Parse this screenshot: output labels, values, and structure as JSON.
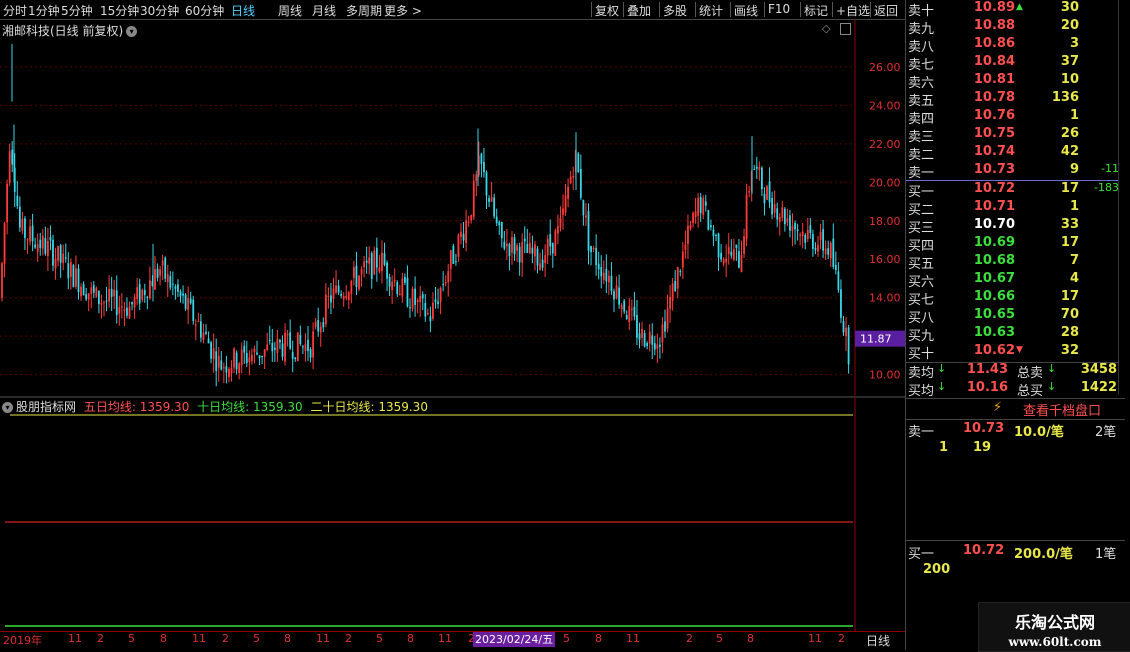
{
  "toolbar": {
    "left_items": [
      "分时",
      "1分钟",
      "5分钟",
      "15分钟",
      "30分钟",
      "60分钟",
      "日线",
      "周线",
      "月线",
      "多周期",
      "更多 >"
    ],
    "active_index": 6,
    "right_items": [
      "复权",
      "叠加",
      "多股",
      "统计",
      "画线",
      "F10",
      "标记",
      "+自选",
      "返回"
    ]
  },
  "chart": {
    "title": "湘邮科技(日线 前复权)",
    "price_ticks": [
      "26.00",
      "24.00",
      "22.00",
      "20.00",
      "18.00",
      "16.00",
      "14.00",
      "12.00",
      "10.00"
    ],
    "price_range": [
      9.2,
      27.4
    ],
    "current_price_label": "11.87",
    "current_price": 11.87,
    "up_color": "#ff3b3b",
    "down_color": "#38d6e6"
  },
  "indicator": {
    "name": "股朋指标网",
    "ma5_label": "五日均线: 1359.30",
    "ma10_label": "十日均线: 1359.30",
    "ma20_label": "二十日均线: 1359.30"
  },
  "date_axis": {
    "labels": [
      "2019年",
      "11",
      "2",
      "5",
      "8",
      "11",
      "2",
      "5",
      "8",
      "11",
      "2",
      "5",
      "8",
      "11",
      "2",
      "5",
      "8",
      "11",
      "2",
      "5",
      "8",
      "11",
      "2"
    ],
    "highlight": "2023/02/24/五",
    "period_label": "日线"
  },
  "order_book": {
    "sells": [
      {
        "label": "卖十",
        "price": "10.89",
        "vol": "30",
        "chg": "",
        "price_color": "red",
        "marker": "up"
      },
      {
        "label": "卖九",
        "price": "10.88",
        "vol": "20",
        "chg": "",
        "price_color": "red"
      },
      {
        "label": "卖八",
        "price": "10.86",
        "vol": "3",
        "chg": "",
        "price_color": "red"
      },
      {
        "label": "卖七",
        "price": "10.84",
        "vol": "37",
        "chg": "",
        "price_color": "red"
      },
      {
        "label": "卖六",
        "price": "10.81",
        "vol": "10",
        "chg": "",
        "price_color": "red"
      },
      {
        "label": "卖五",
        "price": "10.78",
        "vol": "136",
        "chg": "",
        "price_color": "red"
      },
      {
        "label": "卖四",
        "price": "10.76",
        "vol": "1",
        "chg": "",
        "price_color": "red"
      },
      {
        "label": "卖三",
        "price": "10.75",
        "vol": "26",
        "chg": "",
        "price_color": "red"
      },
      {
        "label": "卖二",
        "price": "10.74",
        "vol": "42",
        "chg": "",
        "price_color": "red"
      },
      {
        "label": "卖一",
        "price": "10.73",
        "vol": "9",
        "chg": "-11",
        "price_color": "red"
      }
    ],
    "buys": [
      {
        "label": "买一",
        "price": "10.72",
        "vol": "17",
        "chg": "-183",
        "price_color": "red"
      },
      {
        "label": "买二",
        "price": "10.71",
        "vol": "1",
        "chg": "",
        "price_color": "red"
      },
      {
        "label": "买三",
        "price": "10.70",
        "vol": "33",
        "chg": "",
        "price_color": "white"
      },
      {
        "label": "买四",
        "price": "10.69",
        "vol": "17",
        "chg": "",
        "price_color": "green"
      },
      {
        "label": "买五",
        "price": "10.68",
        "vol": "7",
        "chg": "",
        "price_color": "green"
      },
      {
        "label": "买六",
        "price": "10.67",
        "vol": "4",
        "chg": "",
        "price_color": "green"
      },
      {
        "label": "买七",
        "price": "10.66",
        "vol": "17",
        "chg": "",
        "price_color": "green"
      },
      {
        "label": "买八",
        "price": "10.65",
        "vol": "70",
        "chg": "",
        "price_color": "green"
      },
      {
        "label": "买九",
        "price": "10.63",
        "vol": "28",
        "chg": "",
        "price_color": "green"
      },
      {
        "label": "买十",
        "price": "10.62",
        "vol": "32",
        "chg": "",
        "price_color": "red",
        "marker": "down"
      }
    ],
    "avg_sell_label": "卖均",
    "avg_sell": "11.43",
    "total_sell_label": "总卖",
    "total_sell": "3458",
    "avg_buy_label": "买均",
    "avg_buy": "10.16",
    "total_buy_label": "总买",
    "total_buy": "1422",
    "depth_button": "查看千档盘口",
    "sell1_label": "卖一",
    "sell1_price": "10.73",
    "sell1_amount": "10.0/笔",
    "sell1_count": "2笔",
    "sell1_orders": [
      "1",
      "19"
    ],
    "buy1_label": "买一",
    "buy1_price": "10.72",
    "buy1_amount": "200.0/笔",
    "buy1_count": "1笔",
    "buy1_orders": [
      "200"
    ]
  },
  "watermark": {
    "line1": "乐淘公式网",
    "line2": "www.60lt.com"
  }
}
